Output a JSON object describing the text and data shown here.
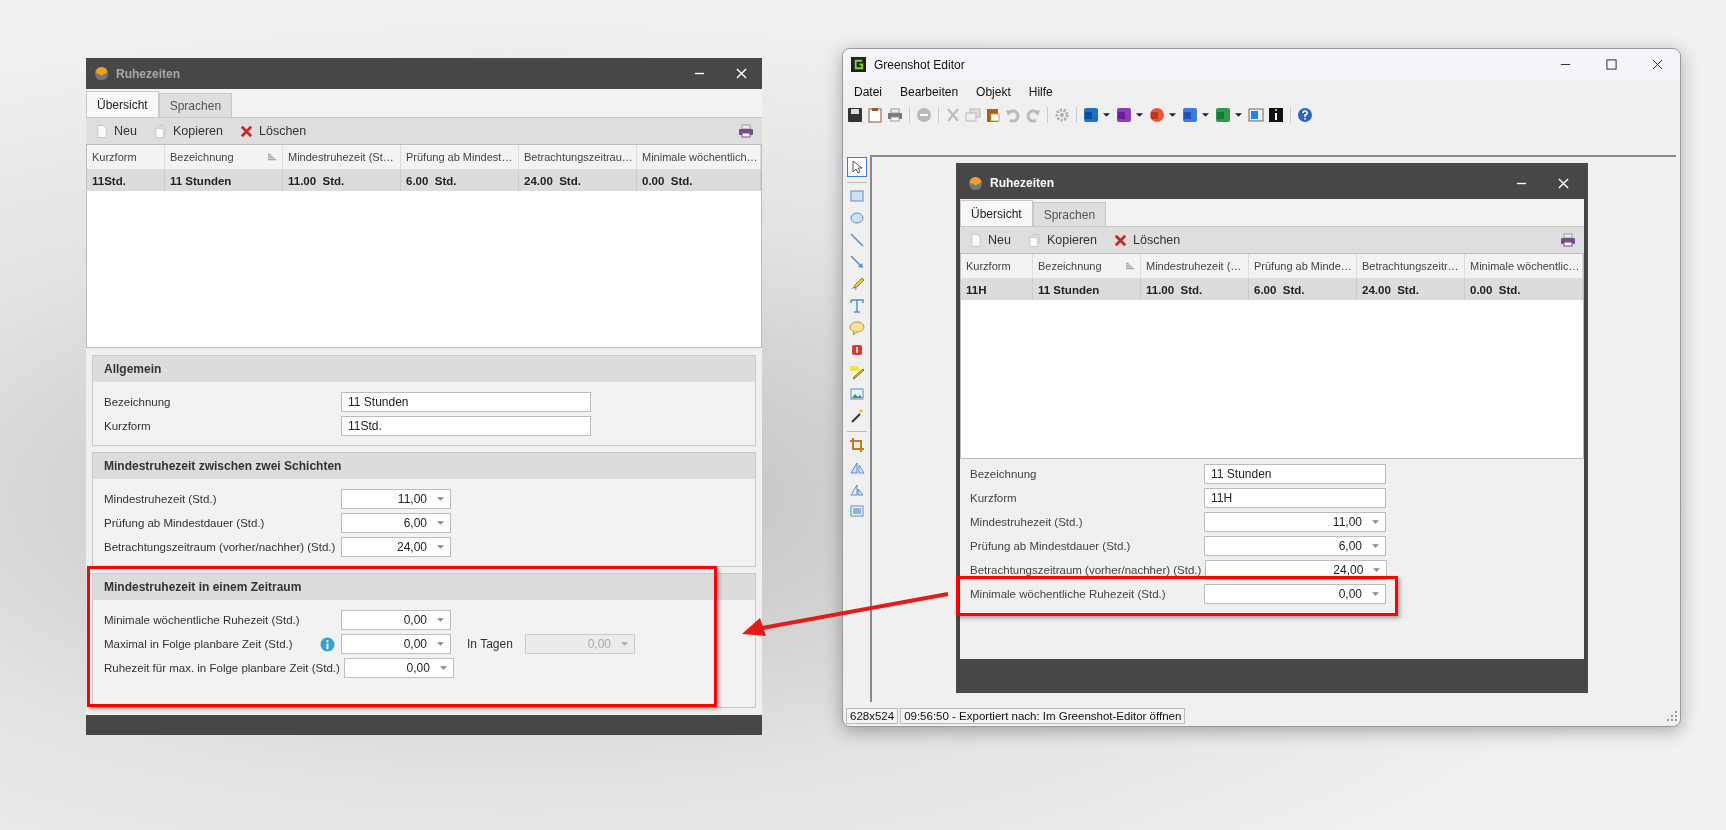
{
  "dialog": {
    "title": "Ruhezeiten",
    "tabs": [
      {
        "label": "Übersicht",
        "selected": true
      },
      {
        "label": "Sprachen",
        "selected": false
      }
    ],
    "toolbar": [
      {
        "kind": "new",
        "label": "Neu"
      },
      {
        "kind": "copy",
        "label": "Kopieren"
      },
      {
        "kind": "delete",
        "label": "Löschen"
      }
    ],
    "columns": [
      {
        "label": "Kurzform",
        "sorted": false
      },
      {
        "label": "Bezeichnung",
        "sorted": true
      },
      {
        "label": "Mindestruhezeit (St…",
        "sorted": false
      },
      {
        "label": "Prüfung ab Mindest…",
        "sorted": false
      },
      {
        "label": "Betrachtungszeitrau…",
        "sorted": false
      },
      {
        "label": "Minimale wöchentlich…",
        "sorted": false
      }
    ],
    "rows": [
      {
        "selected": true,
        "cells": [
          "11Std.",
          "11 Stunden",
          "11.00  Std.",
          "6.00  Std.",
          "24.00  Std.",
          "0.00  Std."
        ]
      }
    ],
    "sections": [
      {
        "title": "Allgemein",
        "fields": [
          {
            "label": "Bezeichnung",
            "kind": "text",
            "value": "11 Stunden",
            "info": false
          },
          {
            "label": "Kurzform",
            "kind": "text",
            "value": "11Std.",
            "info": false
          }
        ]
      },
      {
        "title": "Mindestruhezeit zwischen zwei Schichten",
        "fields": [
          {
            "label": "Mindestruhezeit (Std.)",
            "kind": "spin",
            "value": "11,00",
            "info": false
          },
          {
            "label": "Prüfung ab Mindestdauer (Std.)",
            "kind": "spin",
            "value": "6,00",
            "info": false
          },
          {
            "label": "Betrachtungszeitraum (vorher/nachher) (Std.)",
            "kind": "spin",
            "value": "24,00",
            "info": false
          }
        ]
      },
      {
        "title": "Mindestruhezeit in einem Zeitraum",
        "fields": [
          {
            "label": "Minimale wöchentliche Ruhezeit (Std.)",
            "kind": "spin",
            "value": "0,00",
            "info": false
          },
          {
            "label": "Maximal in Folge planbare Zeit (Std.)",
            "kind": "spin",
            "value": "0,00",
            "info": true,
            "extra": {
              "label": "In Tagen",
              "value": "0,00",
              "disabled": true
            }
          },
          {
            "label": "Ruhezeit für max. in Folge planbare Zeit (Std.)",
            "kind": "spin",
            "value": "0,00",
            "info": false
          }
        ]
      }
    ]
  },
  "editor": {
    "title": "Greenshot Editor",
    "menu": [
      "Datei",
      "Bearbeiten",
      "Objekt",
      "Hilfe"
    ],
    "tools": [
      {
        "kind": "pointer",
        "selected": true
      },
      {
        "kind": "rectangle",
        "selected": false
      },
      {
        "kind": "ellipse",
        "selected": false
      },
      {
        "kind": "line",
        "selected": false
      },
      {
        "kind": "arrow",
        "selected": false
      },
      {
        "kind": "freehand",
        "selected": false
      },
      {
        "kind": "text",
        "selected": false
      },
      {
        "kind": "bubble",
        "selected": false
      },
      {
        "kind": "counter",
        "selected": false
      },
      {
        "kind": "highlight",
        "selected": false
      },
      {
        "kind": "image",
        "selected": false
      },
      {
        "kind": "wand",
        "selected": false
      },
      {
        "kind": "crop",
        "selected": false
      },
      {
        "kind": "rotate-right",
        "selected": false
      },
      {
        "kind": "rotate-left",
        "selected": false
      },
      {
        "kind": "resize",
        "selected": false
      }
    ],
    "capture": {
      "title": "Ruhezeiten",
      "tabs": [
        {
          "label": "Übersicht",
          "selected": true
        },
        {
          "label": "Sprachen",
          "selected": false
        }
      ],
      "toolbar": [
        {
          "kind": "new",
          "label": "Neu"
        },
        {
          "kind": "copy",
          "label": "Kopieren"
        },
        {
          "kind": "delete",
          "label": "Löschen"
        }
      ],
      "columns": [
        {
          "label": "Kurzform",
          "sorted": false
        },
        {
          "label": "Bezeichnung",
          "sorted": true
        },
        {
          "label": "Mindestruhezeit (…",
          "sorted": false
        },
        {
          "label": "Prüfung ab Minde…",
          "sorted": false
        },
        {
          "label": "Betrachtungszeitr…",
          "sorted": false
        },
        {
          "label": "Minimale wöchentlic…",
          "sorted": false
        }
      ],
      "rows": [
        {
          "selected": true,
          "cells": [
            "11H",
            "11 Stunden",
            "11.00  Std.",
            "6.00  Std.",
            "24.00  Std.",
            "0.00  Std."
          ]
        }
      ],
      "sections": [
        {
          "fields": [
            {
              "label": "Bezeichnung",
              "kind": "text",
              "value": "11 Stunden",
              "info": false
            },
            {
              "label": "Kurzform",
              "kind": "text",
              "value": "11H",
              "info": false
            },
            {
              "label": "Mindestruhezeit (Std.)",
              "kind": "spin",
              "value": "11,00",
              "info": false
            },
            {
              "label": "Prüfung ab Mindestdauer (Std.)",
              "kind": "spin",
              "value": "6,00",
              "info": false
            },
            {
              "label": "Betrachtungszeitraum (vorher/nachher) (Std.)",
              "kind": "spin",
              "value": "24,00",
              "info": false
            },
            {
              "label": "Minimale wöchentliche Ruhezeit (Std.)",
              "kind": "spin",
              "value": "0,00",
              "info": false
            }
          ]
        }
      ]
    },
    "status": [
      "628x524",
      "09:56:50 - Exportiert nach: Im Greenshot-Editor öffnen"
    ]
  }
}
